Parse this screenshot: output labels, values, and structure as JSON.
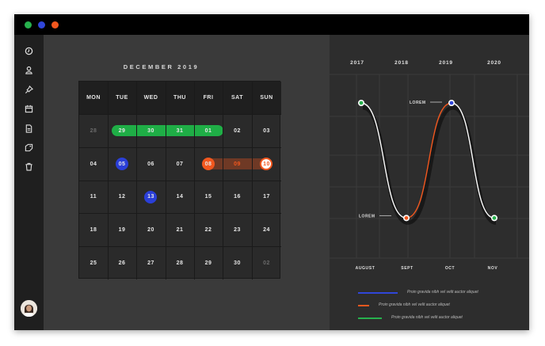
{
  "window": {
    "dots": [
      "#27b14d",
      "#3046d9",
      "#f2571e"
    ]
  },
  "sidebar": {
    "icons": [
      "clock-icon",
      "user-icon",
      "pin-icon",
      "calendar-icon",
      "document-icon",
      "tag-icon",
      "trash-icon"
    ],
    "avatar": "avatar"
  },
  "calendar": {
    "title": "DECEMBER 2019",
    "weekdays": [
      "MON",
      "TUE",
      "WED",
      "THU",
      "FRI",
      "SAT",
      "SUN"
    ],
    "weeks": [
      [
        "28",
        "29",
        "30",
        "31",
        "01",
        "02",
        "03"
      ],
      [
        "04",
        "05",
        "06",
        "07",
        "08",
        "09",
        "10"
      ],
      [
        "11",
        "12",
        "13",
        "14",
        "15",
        "16",
        "17"
      ],
      [
        "18",
        "19",
        "20",
        "21",
        "22",
        "23",
        "24"
      ],
      [
        "25",
        "26",
        "27",
        "28",
        "29",
        "30",
        "02"
      ]
    ],
    "muted_days": [
      "0-0",
      "4-6"
    ],
    "highlights": {
      "green_range": [
        "29",
        "30",
        "31",
        "01"
      ],
      "blue_days": [
        "05",
        "13"
      ],
      "orange_range": [
        "08",
        "09",
        "10"
      ]
    },
    "colors": {
      "green": "#1fae46",
      "blue": "#2a3fd8",
      "orange": "#f2571e"
    }
  },
  "chart": {
    "years": [
      "2017",
      "2018",
      "2019",
      "2020"
    ],
    "months": [
      "AUGUST",
      "SEPT",
      "OCT",
      "NOV"
    ],
    "annotations": [
      "LOREM",
      "LOREM"
    ],
    "legend": [
      {
        "label": "Proin gravida nibh vel velit auctor aliquet",
        "color": "#3046d9"
      },
      {
        "label": "Proin gravida nibh vel velit auctor aliquet",
        "color": "#f2571e"
      },
      {
        "label": "Proin gravida nibh vel velit auctor aliquet",
        "color": "#27b14d"
      }
    ]
  },
  "chart_data": {
    "type": "line",
    "categories": [
      "AUGUST",
      "SEPT",
      "OCT",
      "NOV"
    ],
    "series": [
      {
        "values": [
          1.0,
          0.05,
          1.0,
          0.05
        ]
      }
    ],
    "ylim": [
      0,
      1
    ],
    "title": "",
    "xlabel": "",
    "ylabel": ""
  }
}
